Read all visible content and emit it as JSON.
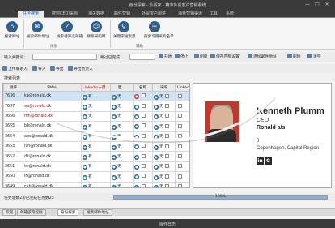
{
  "window": {
    "title": "身份探索 - 外贸家 - 精准外贸客户营销系统",
    "min": "—",
    "max": "□",
    "close": "✕"
  },
  "menu": {
    "tabs": [
      "任务搜索",
      "搜到CEO/采购",
      "海关数据",
      "邮件营销",
      "外贸客户跟进",
      "海量营销渠道",
      "工具",
      "系统"
    ],
    "active": 0
  },
  "ribbon": {
    "buttons": [
      {
        "label": "搜索网站",
        "icon": "web-icon"
      },
      {
        "label": "搜索邮件地址",
        "icon": "mail-search-icon"
      },
      {
        "label": "搜索待筛选邮箱",
        "icon": "filter-icon"
      },
      {
        "label": "联系采购网",
        "icon": "contact-icon"
      },
      {
        "label": "关键字搜索量",
        "icon": "keyword-icon"
      },
      {
        "label": "搜索可用采购名单",
        "icon": "list-icon"
      }
    ],
    "groups": [
      "搜索",
      "辅助"
    ]
  },
  "inputs": {
    "keyword_label": "输入关键词：",
    "dept_label": "跳过已完成：",
    "start": "开始",
    "stop": "停止",
    "refresh": "刷新",
    "save_all": "保存匹配设置",
    "add_mail": "添加邮件地址",
    "delete": "删除",
    "clear": "清空"
  },
  "toolbar2": {
    "upload": "上传联系人",
    "import": "导入",
    "export": "导出",
    "export_contacts": "导出负责人"
  },
  "list": {
    "label": "搜索列表"
  },
  "grid": {
    "headers": [
      "顺序",
      "EMail",
      "LinkedIn一键...",
      "匿...",
      "名称",
      "采购",
      "Linked"
    ],
    "rows": [
      {
        "seq": "7636",
        "email": "kp@ronald.dk",
        "email_color": "#222",
        "li": "有",
        "an": "无",
        "name": "",
        "buy": "无",
        "sel": true
      },
      {
        "seq": "7637",
        "email": "an@ronald.dk",
        "email_color": "#c00",
        "li": "无",
        "an": "无",
        "name": "",
        "buy": "无",
        "sel": false
      },
      {
        "seq": "3656",
        "email": "mh@ronald.dk",
        "email_color": "#c00",
        "li": "无",
        "an": "无",
        "name": "",
        "buy": "无",
        "sel": false
      },
      {
        "seq": "3655",
        "email": "bb@ronald.dk",
        "email_color": "#222",
        "li": "有",
        "an": "无",
        "name": "",
        "buy": "无",
        "sel": false
      },
      {
        "seq": "3654",
        "email": "ans@ronald.dk",
        "email_color": "#222",
        "li": "有",
        "an": "无",
        "name": "",
        "buy": "无",
        "sel": false
      },
      {
        "seq": "3653",
        "email": "lvh@ronald.dk",
        "email_color": "#222",
        "li": "有",
        "an": "无",
        "name": "",
        "buy": "无",
        "sel": false
      },
      {
        "seq": "3652",
        "email": "dk@ronald.dk",
        "email_color": "#222",
        "li": "有",
        "an": "无",
        "name": "",
        "buy": "无",
        "sel": false
      },
      {
        "seq": "3651",
        "email": "kv@ronald.dk",
        "email_color": "#222",
        "li": "有",
        "an": "无",
        "name": "",
        "buy": "无",
        "sel": false
      },
      {
        "seq": "3650",
        "email": "lh@ronald.dk",
        "email_color": "#222",
        "li": "有",
        "an": "无",
        "name": "",
        "buy": "无",
        "sel": false
      },
      {
        "seq": "3649",
        "email": "cah@ronald.dk",
        "email_color": "#222",
        "li": "有",
        "an": "无",
        "name": "",
        "buy": "无",
        "sel": false
      }
    ]
  },
  "detail": {
    "name": "Kenneth Plumm",
    "title": "CEO",
    "company": "Ronald a/s",
    "zero": "0",
    "location": "Copenhagen, Capital Region",
    "icons": [
      "in",
      "G"
    ]
  },
  "status": {
    "text": "任务总数23/已完成任务数23",
    "progress_text": "100%",
    "progress": 1.0
  },
  "doctabs": [
    "欢迎",
    "邮箱该再挖掘",
    "身份探索",
    "搜集邮件地址"
  ],
  "doctab_active": 2,
  "bottom": {
    "text": "操作日志"
  }
}
